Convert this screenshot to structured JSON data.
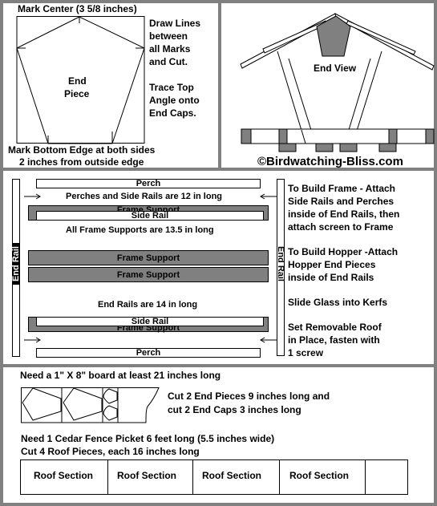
{
  "end_piece_panel": {
    "mark_center": "Mark Center (3 5/8 inches)",
    "piece_label_1": "End",
    "piece_label_2": "Piece",
    "instructions": [
      "Draw Lines",
      "between",
      "all Marks",
      "and Cut.",
      "",
      "Trace Top",
      "Angle onto",
      "End Caps."
    ],
    "bottom_note_1": "Mark Bottom Edge at both sides",
    "bottom_note_2": "2 inches from outside edge"
  },
  "end_view_panel": {
    "label": "End View",
    "copyright": "©Birdwatching-Bliss.com"
  },
  "frame_panel": {
    "perch_top": "Perch",
    "perch_note": "Perches and Side Rails are 12 in long",
    "frame_support_top": "Frame Support",
    "side_rail_top": "Side Rail",
    "frame_support_note": "All Frame Supports are 13.5 in long",
    "frame_support_mid_1": "Frame Support",
    "frame_support_mid_2": "Frame Support",
    "end_rail_note": "End Rails are 14 in long",
    "side_rail_bottom": "Side Rail",
    "frame_support_bottom": "Frame Support",
    "perch_bottom": "Perch",
    "end_rail_left": "End Rail",
    "end_rail_right": "End Rail",
    "instructions": [
      "To Build Frame - Attach",
      "Side Rails and Perches",
      "inside of End Rails, then",
      "attach screen to Frame",
      "",
      "To Build Hopper -Attach",
      "Hopper End Pieces",
      "inside of End Rails",
      "",
      "Slide Glass into Kerfs",
      "",
      "Set Removable Roof",
      "in Place, fasten with",
      "1 screw"
    ]
  },
  "materials_panel": {
    "board_note": "Need a 1\" X 8\" board at least 21 inches long",
    "cut_note_1": "Cut 2 End Pieces 9 inches long and",
    "cut_note_2": "cut 2 End Caps 3 inches long",
    "picket_note_1": "Need 1 Cedar Fence Picket 6 feet long (5.5 inches wide)",
    "picket_note_2": "Cut 4 Roof Pieces, each 16 inches long",
    "roof_sections": [
      "Roof Section",
      "Roof Section",
      "Roof Section",
      "Roof Section",
      ""
    ]
  },
  "colors": {
    "border": "#808080",
    "wood_fill": "#808080",
    "background": "#ffffff"
  }
}
